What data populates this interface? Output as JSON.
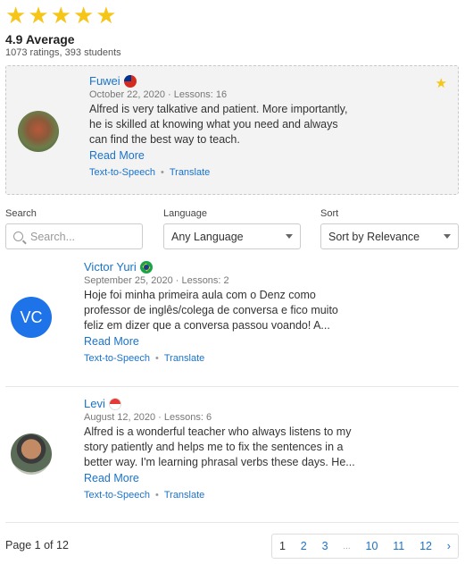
{
  "rating": {
    "stars": 5,
    "average": "4.9 Average",
    "counts": "1073 ratings, 393 students",
    "star_color": "#f5c518"
  },
  "featured_review": {
    "name": "Fuwei",
    "meta": "October 22, 2020 · Lessons: 16",
    "body_lines": [
      "Alfred is very talkative and patient. More importantly,",
      "he is skilled at knowing what you need and always",
      "can find the best way to teach."
    ],
    "read_more": "Read More",
    "tts": "Text-to-Speech",
    "translate": "Translate",
    "flag_icon": "taiwan-flag-icon"
  },
  "filters": {
    "search_label": "Search",
    "search_placeholder": "Search...",
    "language_label": "Language",
    "language_value": "Any Language",
    "sort_label": "Sort",
    "sort_value": "Sort by Relevance"
  },
  "reviews": [
    {
      "initials": "VC",
      "name": "Victor Yuri",
      "meta": "September 25, 2020 · Lessons: 2",
      "body_lines": [
        "Hoje foi minha primeira aula com o Denz como",
        "professor de inglês/colega de conversa e fico muito",
        "feliz em dizer que a conversa passou voando! A..."
      ],
      "read_more": "Read More",
      "tts": "Text-to-Speech",
      "translate": "Translate",
      "flag_icon": "brazil-flag-icon"
    },
    {
      "name": "Levi",
      "meta": "August 12, 2020 · Lessons: 6",
      "body_lines": [
        "Alfred is a wonderful teacher who always listens to my",
        "story patiently and helps me to fix the sentences in a",
        "better way. I'm learning phrasal verbs these days. He..."
      ],
      "read_more": "Read More",
      "tts": "Text-to-Speech",
      "translate": "Translate",
      "flag_icon": "singapore-flag-icon"
    }
  ],
  "pagination": {
    "label": "Page 1 of 12",
    "pages": [
      "1",
      "2",
      "3",
      "...",
      "10",
      "11",
      "12",
      "›"
    ],
    "current": "1"
  },
  "colors": {
    "link": "#1a73c9",
    "avatar_bg": "#1e73e8"
  }
}
